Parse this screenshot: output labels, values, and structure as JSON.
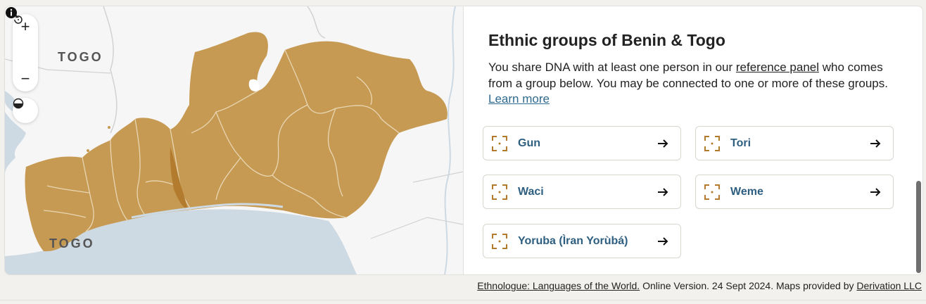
{
  "map": {
    "country_label": "TOGO",
    "controls": {
      "zoom_in": "+",
      "reset": "reset",
      "zoom_out": "−",
      "theme": "theme"
    },
    "region_color": "#c69a52",
    "water_color": "#cdd9e3"
  },
  "panel": {
    "title": "Ethnic groups of Benin & Togo",
    "desc_part1": "You share DNA with at least one person in our ",
    "reference_link": "reference panel",
    "desc_part2": " who comes from a group below. You may be connected to one or more of these groups. ",
    "learn_more": "Learn more",
    "groups": [
      {
        "label": "Gun"
      },
      {
        "label": "Tori"
      },
      {
        "label": "Waci"
      },
      {
        "label": "Weme"
      },
      {
        "label": "Yoruba (Ìran Yorùbá)"
      }
    ]
  },
  "footer": {
    "source_link": "Ethnologue: Languages of the World.",
    "source_text": " Online Version. 24 Sept 2024. Maps provided by ",
    "maps_link": "Derivation LLC"
  }
}
